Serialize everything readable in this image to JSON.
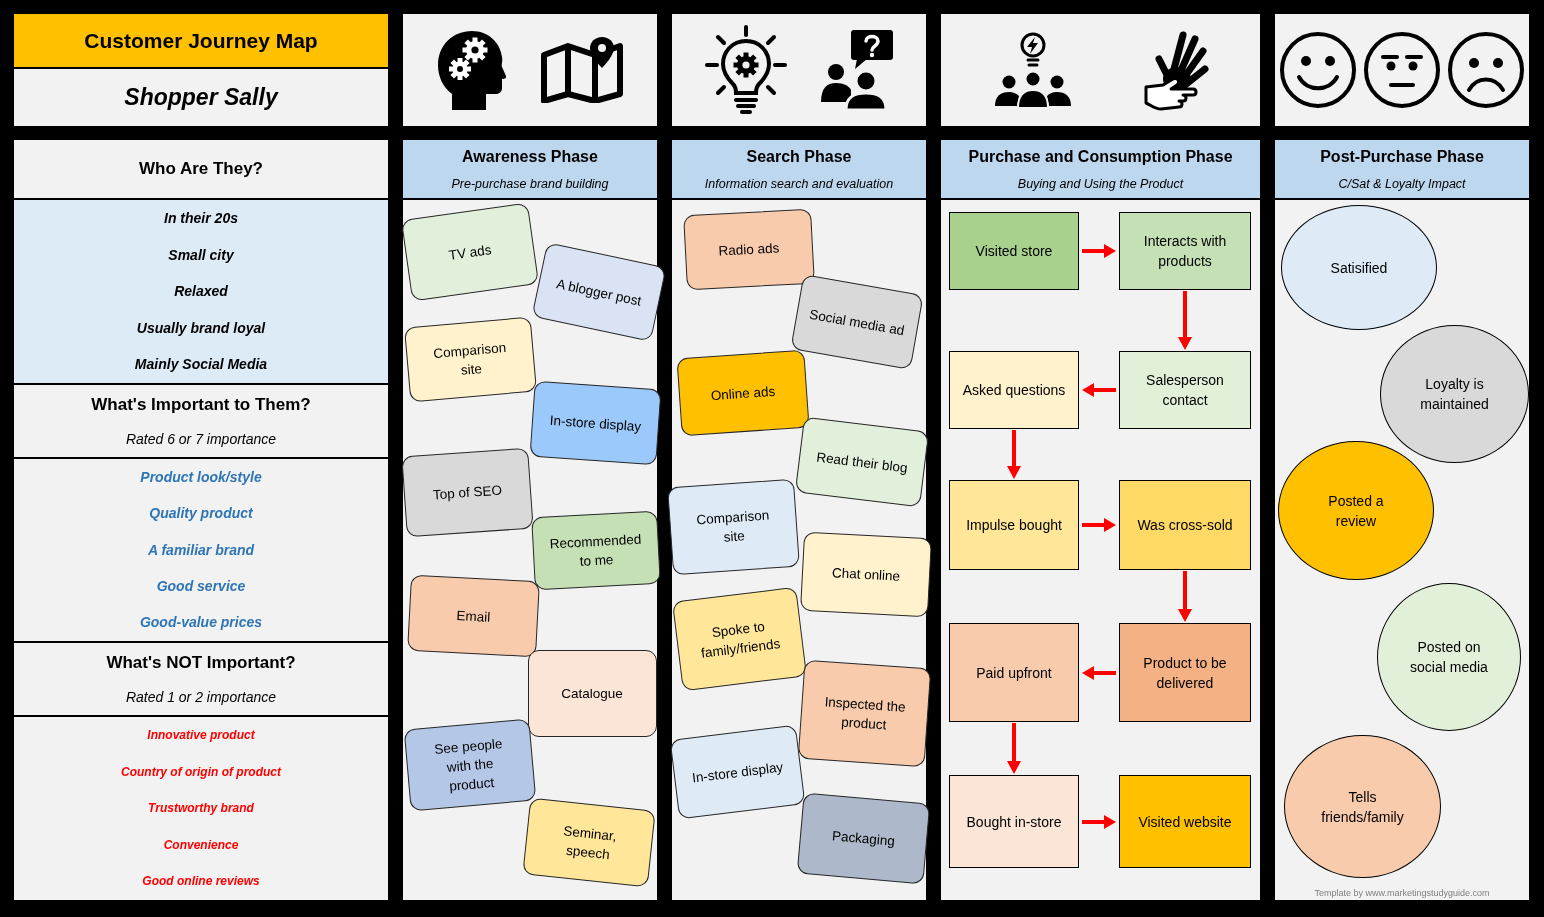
{
  "title": "Customer Journey Map",
  "persona": "Shopper Sally",
  "profile_sections": [
    {
      "kind": "profile",
      "heading": "Who Are They?",
      "items": [
        "In their 20s",
        "Small city",
        "Relaxed",
        "Usually brand loyal",
        "Mainly Social Media"
      ]
    },
    {
      "kind": "important",
      "heading": "What's Important to Them?",
      "subheading": "Rated 6 or 7 importance",
      "items": [
        "Product look/style",
        "Quality product",
        "A familiar brand",
        "Good service",
        "Good-value prices"
      ]
    },
    {
      "kind": "not_important",
      "heading": "What's NOT Important?",
      "subheading": "Rated 1 or 2 importance",
      "items": [
        "Innovative product",
        "Country of origin of product",
        "Trustworthy brand",
        "Convenience",
        "Good online reviews"
      ]
    }
  ],
  "phases": [
    {
      "kind": "notes",
      "title": "Awareness Phase",
      "subtitle": "Pre-purchase brand building",
      "items": [
        {
          "text": "TV ads",
          "color": "#e2efda"
        },
        {
          "text": "A blogger post",
          "color": "#dae3f3"
        },
        {
          "text": "Comparison site",
          "color": "#fff2cc"
        },
        {
          "text": "In-store display",
          "color": "#9bc9fb"
        },
        {
          "text": "Top of SEO",
          "color": "#d9d9d9"
        },
        {
          "text": "Recommended to me",
          "color": "#c5e0b4"
        },
        {
          "text": "Email",
          "color": "#f8cbad"
        },
        {
          "text": "Catalogue",
          "color": "#fbe5d6"
        },
        {
          "text": "See people with the product",
          "color": "#b4c7e7"
        },
        {
          "text": "Seminar, speech",
          "color": "#ffe699"
        }
      ]
    },
    {
      "kind": "notes",
      "title": "Search Phase",
      "subtitle": "Information search and evaluation",
      "items": [
        {
          "text": "Radio ads",
          "color": "#f8cbad"
        },
        {
          "text": "Social media ad",
          "color": "#d9d9d9"
        },
        {
          "text": "Online ads",
          "color": "#ffc000"
        },
        {
          "text": "Read their blog",
          "color": "#e2efda"
        },
        {
          "text": "Comparison site",
          "color": "#deebf7"
        },
        {
          "text": "Chat online",
          "color": "#fff2cc"
        },
        {
          "text": "Spoke to family/friends",
          "color": "#ffe699"
        },
        {
          "text": "Inspected the product",
          "color": "#f8cbad"
        },
        {
          "text": "In-store display",
          "color": "#deebf7"
        },
        {
          "text": "Packaging",
          "color": "#adb9ca"
        }
      ]
    },
    {
      "kind": "flow",
      "title": "Purchase and Consumption Phase",
      "subtitle": "Buying and Using the Product",
      "items": [
        {
          "kind": "right",
          "text": "Visited store",
          "color": "#a9d18e"
        },
        {
          "kind": "down",
          "text": "Asked questions",
          "color": "#fff2cc"
        },
        {
          "kind": "right",
          "text": "Impulse bought",
          "color": "#ffe699"
        },
        {
          "kind": "down",
          "text": "Paid upfront",
          "color": "#f8cbad"
        },
        {
          "kind": "right",
          "text": "Bought in-store",
          "color": "#fbe5d6"
        },
        {
          "kind": "down",
          "text": "Interacts with products",
          "color": "#c5e0b4"
        },
        {
          "kind": "left",
          "text": "Salesperson contact",
          "color": "#e2f0d9"
        },
        {
          "kind": "down",
          "text": "Was cross-sold",
          "color": "#ffd966"
        },
        {
          "kind": "left",
          "text": "Product to be delivered",
          "color": "#f4b183"
        },
        {
          "kind": "end",
          "text": "Visited website",
          "color": "#ffc000"
        }
      ]
    },
    {
      "kind": "ovals",
      "title": "Post-Purchase Phase",
      "subtitle": "C/Sat & Loyalty Impact",
      "items": [
        {
          "text": "Satisified",
          "color": "#deebf7"
        },
        {
          "text": "Loyalty is maintained",
          "color": "#d9d9d9"
        },
        {
          "text": "Posted a review",
          "color": "#ffc000"
        },
        {
          "text": "Posted on social media",
          "color": "#e2f0d9"
        },
        {
          "text": "Tells friends/family",
          "color": "#f8cbad"
        }
      ],
      "footnote": "Template by www.marketingstudyguide.com"
    }
  ]
}
